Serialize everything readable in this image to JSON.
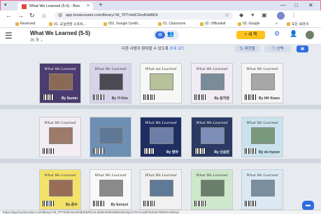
{
  "browser": {
    "tab_title": "What We Learned (5-5) - Boo",
    "address_url": "app.bookcreator.com/library/-Nl_TP7nhdC9ooRdd6Kb",
    "bookmarks": [
      "Reserved",
      "01. 교실현장 소프트...",
      "001. Google Certifi...",
      "01. Classroom",
      "02. Officedell",
      "03. Google"
    ],
    "bookmarks_more": "»",
    "all_bookmarks": "모든 북마크"
  },
  "app": {
    "book_title": "What We Learned (5-5)",
    "page_count": "25 개 ⌄",
    "new_button": "+ 새 책",
    "collab_text": "다른 사람이 참여할 수 있도록",
    "collab_link": "초대 코드",
    "button_order": "⇅ 재정렬",
    "button_select": "◎ 선택"
  },
  "books": [
    {
      "title": "What We Learned",
      "author": "By Sumin",
      "bg": "#4b3b6e",
      "pic": "#8a6a55",
      "dark": true
    },
    {
      "title": "What We Learned",
      "author": "By YI Kim",
      "bg": "#d8d3ea",
      "pic": "#4a4a52",
      "dark": false
    },
    {
      "title": "What we Learned",
      "author": "",
      "bg": "#f7f7f5",
      "pic": "#b7c19a",
      "dark": false
    },
    {
      "title": "What We Learned",
      "author": "By 윤지현",
      "bg": "#f1ecf4",
      "pic": "#7a8b9a",
      "dark": false
    },
    {
      "title": "What We Learned",
      "author": "By HK Kwon",
      "bg": "#f5f5f5",
      "pic": "#a7a7a7",
      "dark": false
    },
    {
      "title": "What We Learned",
      "author": "",
      "bg": "#f3ecf2",
      "pic": "#9d7a6a",
      "dark": false
    },
    {
      "title": "",
      "author": "",
      "bg": "#6e8fb4",
      "pic": "#5f7896",
      "dark": true
    },
    {
      "title": "What We Learned",
      "author": "By 영아",
      "bg": "#1f2e62",
      "pic": "#6b7ea8",
      "dark": true
    },
    {
      "title": "What We Learned",
      "author": "By 신승민",
      "bg": "#2b3a63",
      "pic": "#7d8fb8",
      "dark": true
    },
    {
      "title": "What We Learned",
      "author": "By do hyeon",
      "bg": "#c9e3ee",
      "pic": "#7a9a7e",
      "dark": false
    },
    {
      "title": "What We Learned",
      "author": "By 준수",
      "bg": "#f3e26a",
      "pic": "#9a6d57",
      "dark": false
    },
    {
      "title": "What We Learned",
      "author": "By Eunyul",
      "bg": "#f8f8f8",
      "pic": "#8a8a8a",
      "dark": false
    },
    {
      "title": "What We Learned",
      "author": "",
      "bg": "#f1f1f1",
      "pic": "#5d7a96",
      "dark": false
    },
    {
      "title": "What We Learned",
      "author": "",
      "bg": "#cde8cb",
      "pic": "#6a7f6a",
      "dark": false
    },
    {
      "title": "What We Learned",
      "author": "",
      "bg": "#dbe9f2",
      "pic": "#7a8ea0",
      "dark": false
    }
  ],
  "status_url": "https://app.bookcreator.com/library/-Nl_TP7nhdC9ooRdd6Kb/ECHLdsfMYiM9OWiEtsEh3QcGTk-K1ndsFbLb3e78fRE0+ElNwe",
  "icons": {
    "tab_favicon": "book-creator-icon",
    "lock": "site-info-icon",
    "star": "bookmark-star-icon",
    "grid": "grid-view-icon",
    "help": "chat-help-icon"
  }
}
